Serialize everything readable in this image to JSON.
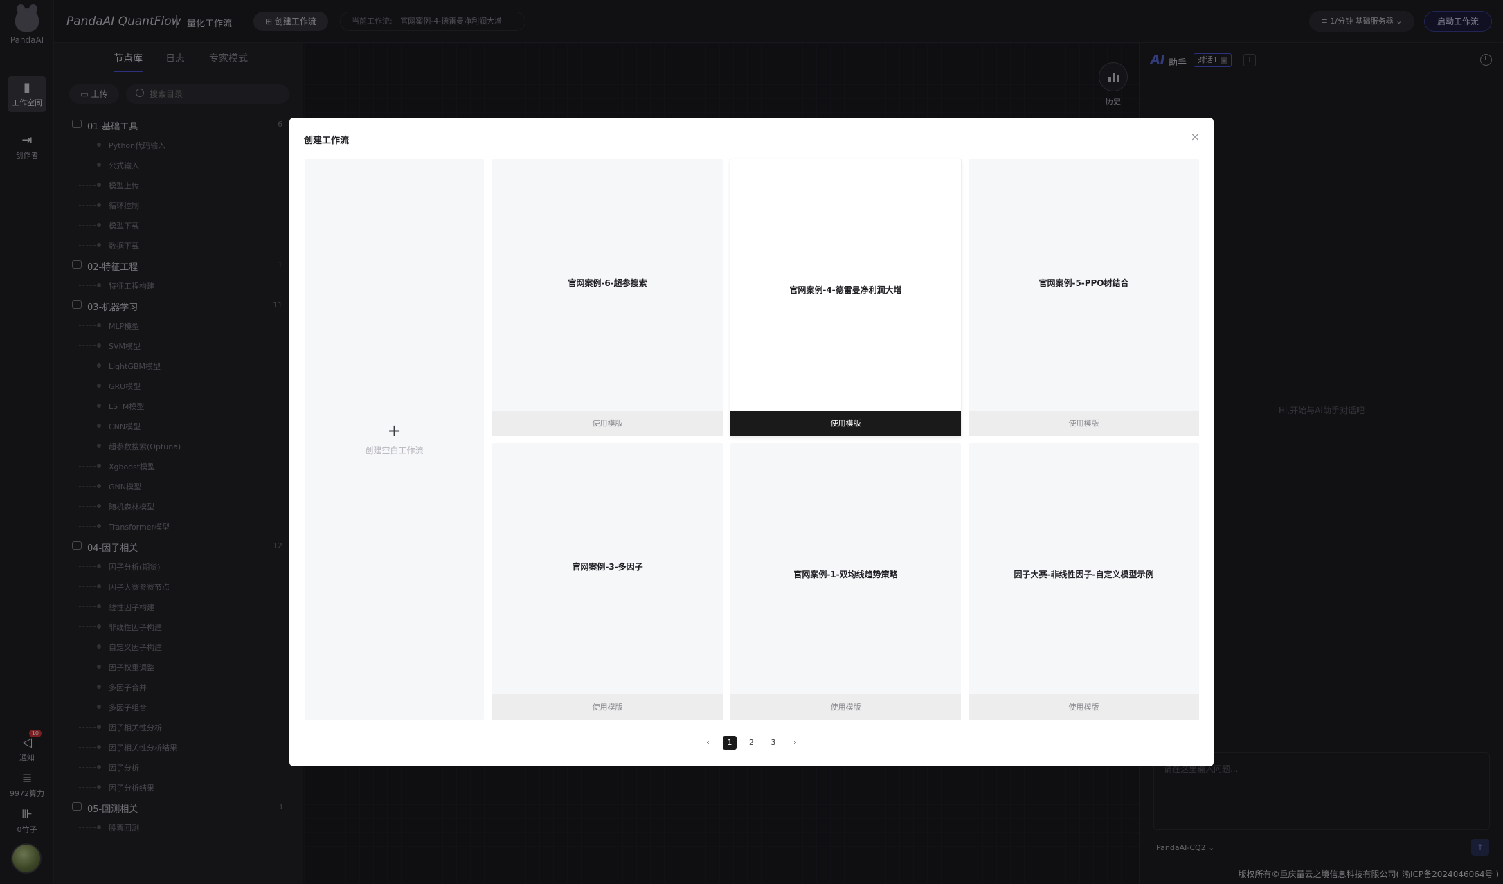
{
  "rail": {
    "logo": "PandaAI",
    "workspace": "工作空间",
    "creator": "创作者",
    "notify": "通知",
    "notify_badge": "10",
    "compute": "9972算力",
    "bamboo": "0竹子"
  },
  "topbar": {
    "brand": "PandaAI QuantFlow",
    "subtitle": "量化工作流",
    "create_btn": "⊞ 创建工作流",
    "current_label": "当前工作流:",
    "current_value": "官网案例-4-德雷曼净利润大增",
    "server": "≡ 1/分钟  基础服务器 ⌄",
    "start_btn": "启动工作流"
  },
  "panel": {
    "tabs": [
      "节点库",
      "日志",
      "专家模式"
    ],
    "upload": "上传",
    "search_placeholder": "搜索目录",
    "groups": [
      {
        "name": "01-基础工具",
        "count": "6",
        "items": [
          "Python代码输入",
          "公式输入",
          "模型上传",
          "循环控制",
          "模型下载",
          "数据下载"
        ]
      },
      {
        "name": "02-特征工程",
        "count": "1",
        "items": [
          "特征工程构建"
        ]
      },
      {
        "name": "03-机器学习",
        "count": "11",
        "items": [
          "MLP模型",
          "SVM模型",
          "LightGBM模型",
          "GRU模型",
          "LSTM模型",
          "CNN模型",
          "超参数搜索(Optuna)",
          "Xgboost模型",
          "GNN模型",
          "随机森林模型",
          "Transformer模型"
        ]
      },
      {
        "name": "04-因子相关",
        "count": "12",
        "items": [
          "因子分析(期货)",
          "因子大赛参赛节点",
          "线性因子构建",
          "非线性因子构建",
          "自定义因子构建",
          "因子权重调整",
          "多因子合并",
          "多因子组合",
          "因子相关性分析",
          "因子相关性分析结果",
          "因子分析",
          "因子分析结果"
        ]
      },
      {
        "name": "05-回测相关",
        "count": "3",
        "items": [
          "股票回测"
        ]
      }
    ]
  },
  "canvas": {
    "history": "历史"
  },
  "ai": {
    "logo": "AI",
    "title": "助手",
    "tab": "对话1",
    "tab_close": "×",
    "add": "+",
    "hint": "Hi,开始与AI助手对话吧",
    "placeholder": "请在这里输入问题...",
    "model": "PandaAI-CQ2 ⌄",
    "send": "↑",
    "footer": "版权所有©重庆量云之境信息科技有限公司( 渝ICP备2024046064号 )"
  },
  "modal": {
    "title": "创建工作流",
    "close": "×",
    "blank_plus": "+",
    "blank_label": "创建空白工作流",
    "use_label": "使用模版",
    "templates": [
      "官网案例-6-超参搜索",
      "官网案例-4-德雷曼净利润大增",
      "官网案例-5-PPO树结合",
      "官网案例-3-多因子",
      "官网案例-1-双均线趋势策略",
      "因子大赛-非线性因子-自定义模型示例"
    ],
    "pager": {
      "prev": "‹",
      "pages": [
        "1",
        "2",
        "3"
      ],
      "next": "›"
    }
  },
  "colors": {
    "accent": "#4a55d8",
    "badge": "#d2343a",
    "dark_button": "#1a1a1a"
  }
}
